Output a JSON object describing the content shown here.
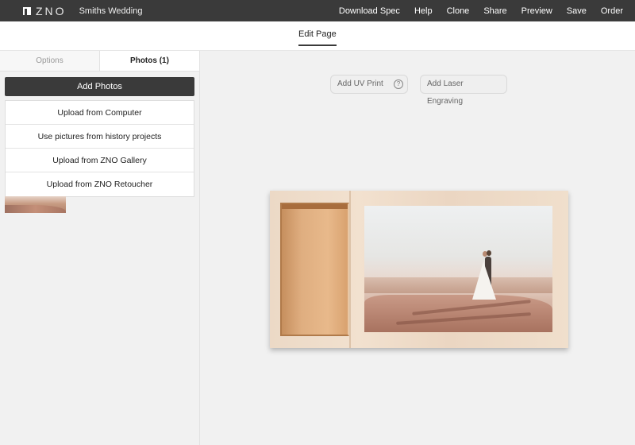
{
  "topbar": {
    "logo_text": "ZNO",
    "project_title": "Smiths Wedding",
    "actions": [
      "Download Spec",
      "Help",
      "Clone",
      "Share",
      "Preview",
      "Save",
      "Order"
    ]
  },
  "subheader": {
    "active_tab": "Edit Page"
  },
  "sidebar": {
    "tabs": {
      "options": "Options",
      "photos": "Photos (1)"
    },
    "add_photos_label": "Add Photos",
    "upload_options": [
      "Upload from Computer",
      "Use pictures from history projects",
      "Upload from ZNO Gallery",
      "Upload from ZNO Retoucher"
    ]
  },
  "canvas": {
    "uv_print_label": "Add UV Print",
    "help_icon_glyph": "?",
    "laser_label": "Add Laser Engraving"
  },
  "colors": {
    "topbar_bg": "#3a3a3a",
    "button_dark": "#3a3a3a",
    "workspace_bg": "#f1f1f1"
  },
  "icons": [
    "zno-logo-icon",
    "help-icon"
  ]
}
